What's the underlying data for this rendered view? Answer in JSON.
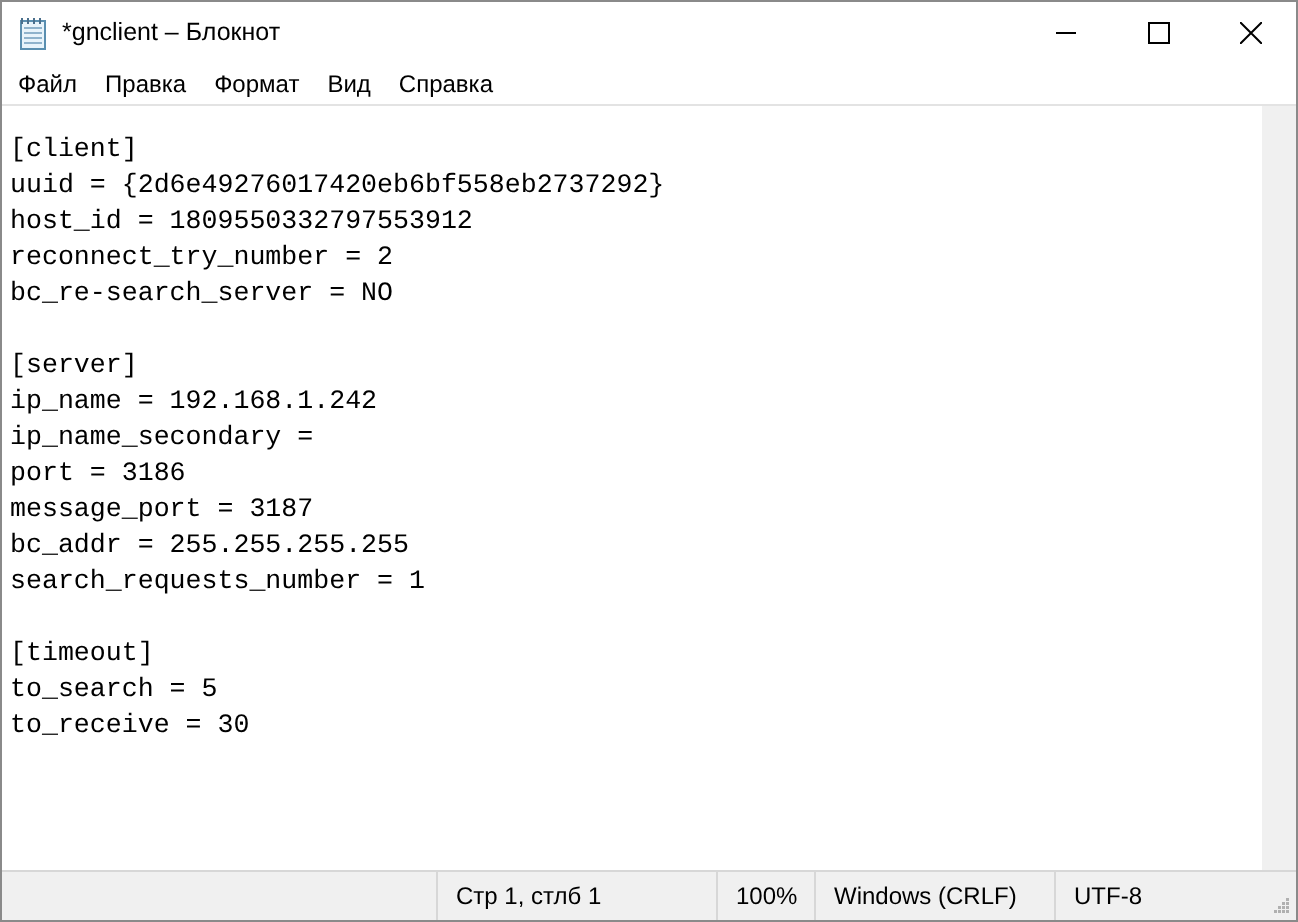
{
  "window": {
    "title": "*gnclient – Блокнот"
  },
  "menu": [
    "Файл",
    "Правка",
    "Формат",
    "Вид",
    "Справка"
  ],
  "editor": {
    "sections": [
      {
        "header": "[client]",
        "lines": [
          "uuid = {2d6e49276017420eb6bf558eb2737292}",
          "host_id = 1809550332797553912",
          "reconnect_try_number = 2",
          "bc_re-search_server = NO"
        ]
      },
      {
        "header": "[server]",
        "lines": [
          "ip_name = 192.168.1.242",
          "ip_name_secondary =",
          "port = 3186",
          "message_port = 3187",
          "bc_addr = 255.255.255.255",
          "search_requests_number = 1"
        ]
      },
      {
        "header": "[timeout]",
        "lines": [
          "to_search = 5",
          "to_receive = 30"
        ]
      }
    ]
  },
  "status_bar": {
    "position": "Стр 1, стлб 1",
    "zoom": "100%",
    "line_endings": "Windows (CRLF)",
    "encoding": "UTF-8"
  }
}
